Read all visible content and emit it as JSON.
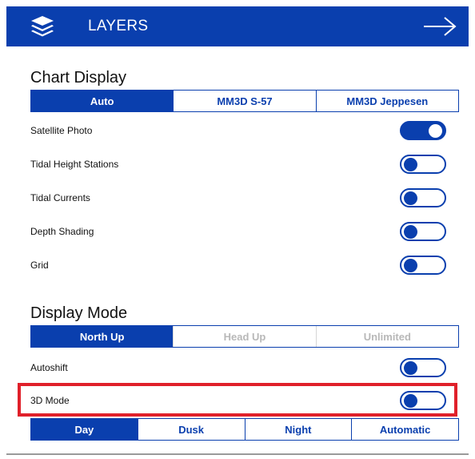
{
  "header": {
    "title": "LAYERS",
    "icon": "layers-icon",
    "close_icon": "arrow-right-icon",
    "color": "#0a3fae"
  },
  "chart_display": {
    "title": "Chart Display",
    "options": [
      "Auto",
      "MM3D S-57",
      "MM3D Jeppesen"
    ],
    "selected": "Auto",
    "rows": [
      {
        "label": "Satellite Photo",
        "on": true
      },
      {
        "label": "Tidal Height Stations",
        "on": false
      },
      {
        "label": "Tidal Currents",
        "on": false
      },
      {
        "label": "Depth Shading",
        "on": false
      },
      {
        "label": "Grid",
        "on": false
      }
    ]
  },
  "display_mode": {
    "title": "Display Mode",
    "options": [
      "North Up",
      "Head Up",
      "Unlimited"
    ],
    "selected": "North Up",
    "disabled": [
      "Head Up",
      "Unlimited"
    ],
    "rows": [
      {
        "label": "Autoshift",
        "on": false
      },
      {
        "label": "3D Mode",
        "on": false
      }
    ],
    "highlight_color": "#e0202a"
  },
  "palette": {
    "options": [
      "Day",
      "Dusk",
      "Night",
      "Automatic"
    ],
    "selected": "Day"
  }
}
